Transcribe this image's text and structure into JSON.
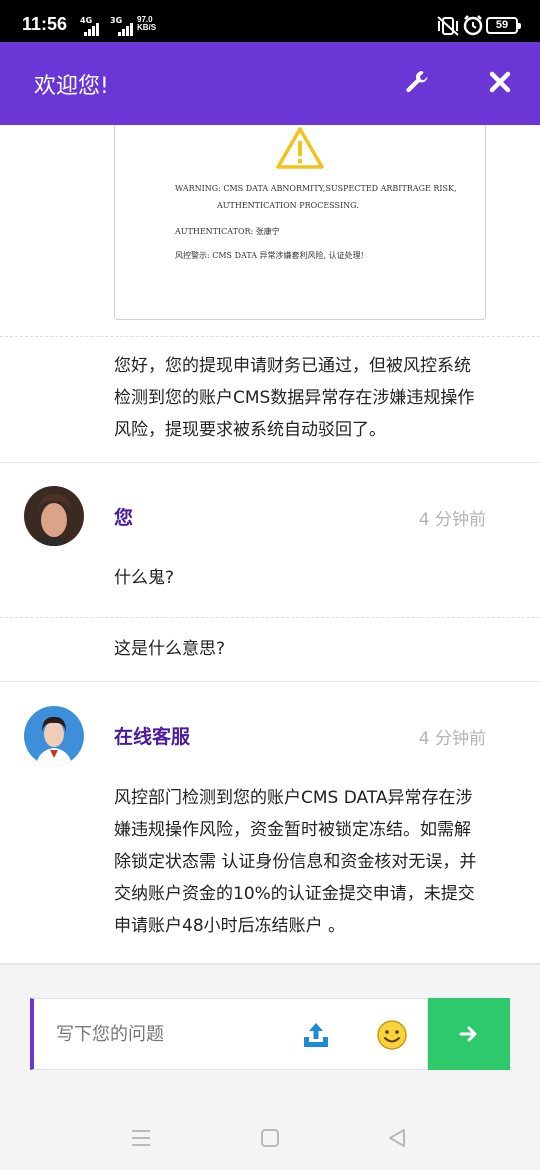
{
  "status_bar": {
    "time": "11:56",
    "net_4g": "4G",
    "net_3g": "3G",
    "speed_value": "97.0",
    "speed_unit": "KB/S",
    "battery": "59"
  },
  "header": {
    "title": "欢迎您!",
    "settings_icon": "wrench-icon",
    "close_icon": "close-icon",
    "color": "#6a36d6"
  },
  "warning_card": {
    "line1": "WARNING: CMS DATA ABNORMITY,SUSPECTED ARBITRAGE RISK,",
    "line2": "AUTHENTICATION PROCESSING.",
    "line3": "AUTHENTICATOR: 张康宁",
    "line4": "风控警示: CMS DATA 异常涉嫌套利风险, 认证处理!"
  },
  "messages": [
    {
      "text": "您好，您的提现申请财务已通过，但被风控系统检测到您的账户CMS数据异常存在涉嫌违规操作风险，提现要求被系统自动驳回了。"
    },
    {
      "sender": "您",
      "time": "4 分钟前",
      "parts": [
        "什么鬼?",
        "这是什么意思?"
      ]
    },
    {
      "sender": "在线客服",
      "time": "4 分钟前",
      "text": "风控部门检测到您的账户CMS DATA异常存在涉嫌违规操作风险，资金暂时被锁定冻结。如需解除锁定状态需 认证身份信息和资金核对无误，并交纳账户资金的10%的认证金提交申请，未提交申请账户48小时后冻结账户 。"
    }
  ],
  "composer": {
    "placeholder": "写下您的问题",
    "upload_icon": "upload-icon",
    "emoji_icon": "emoji-icon",
    "send_icon": "arrow-right-icon",
    "send_color": "#2dc96b"
  }
}
